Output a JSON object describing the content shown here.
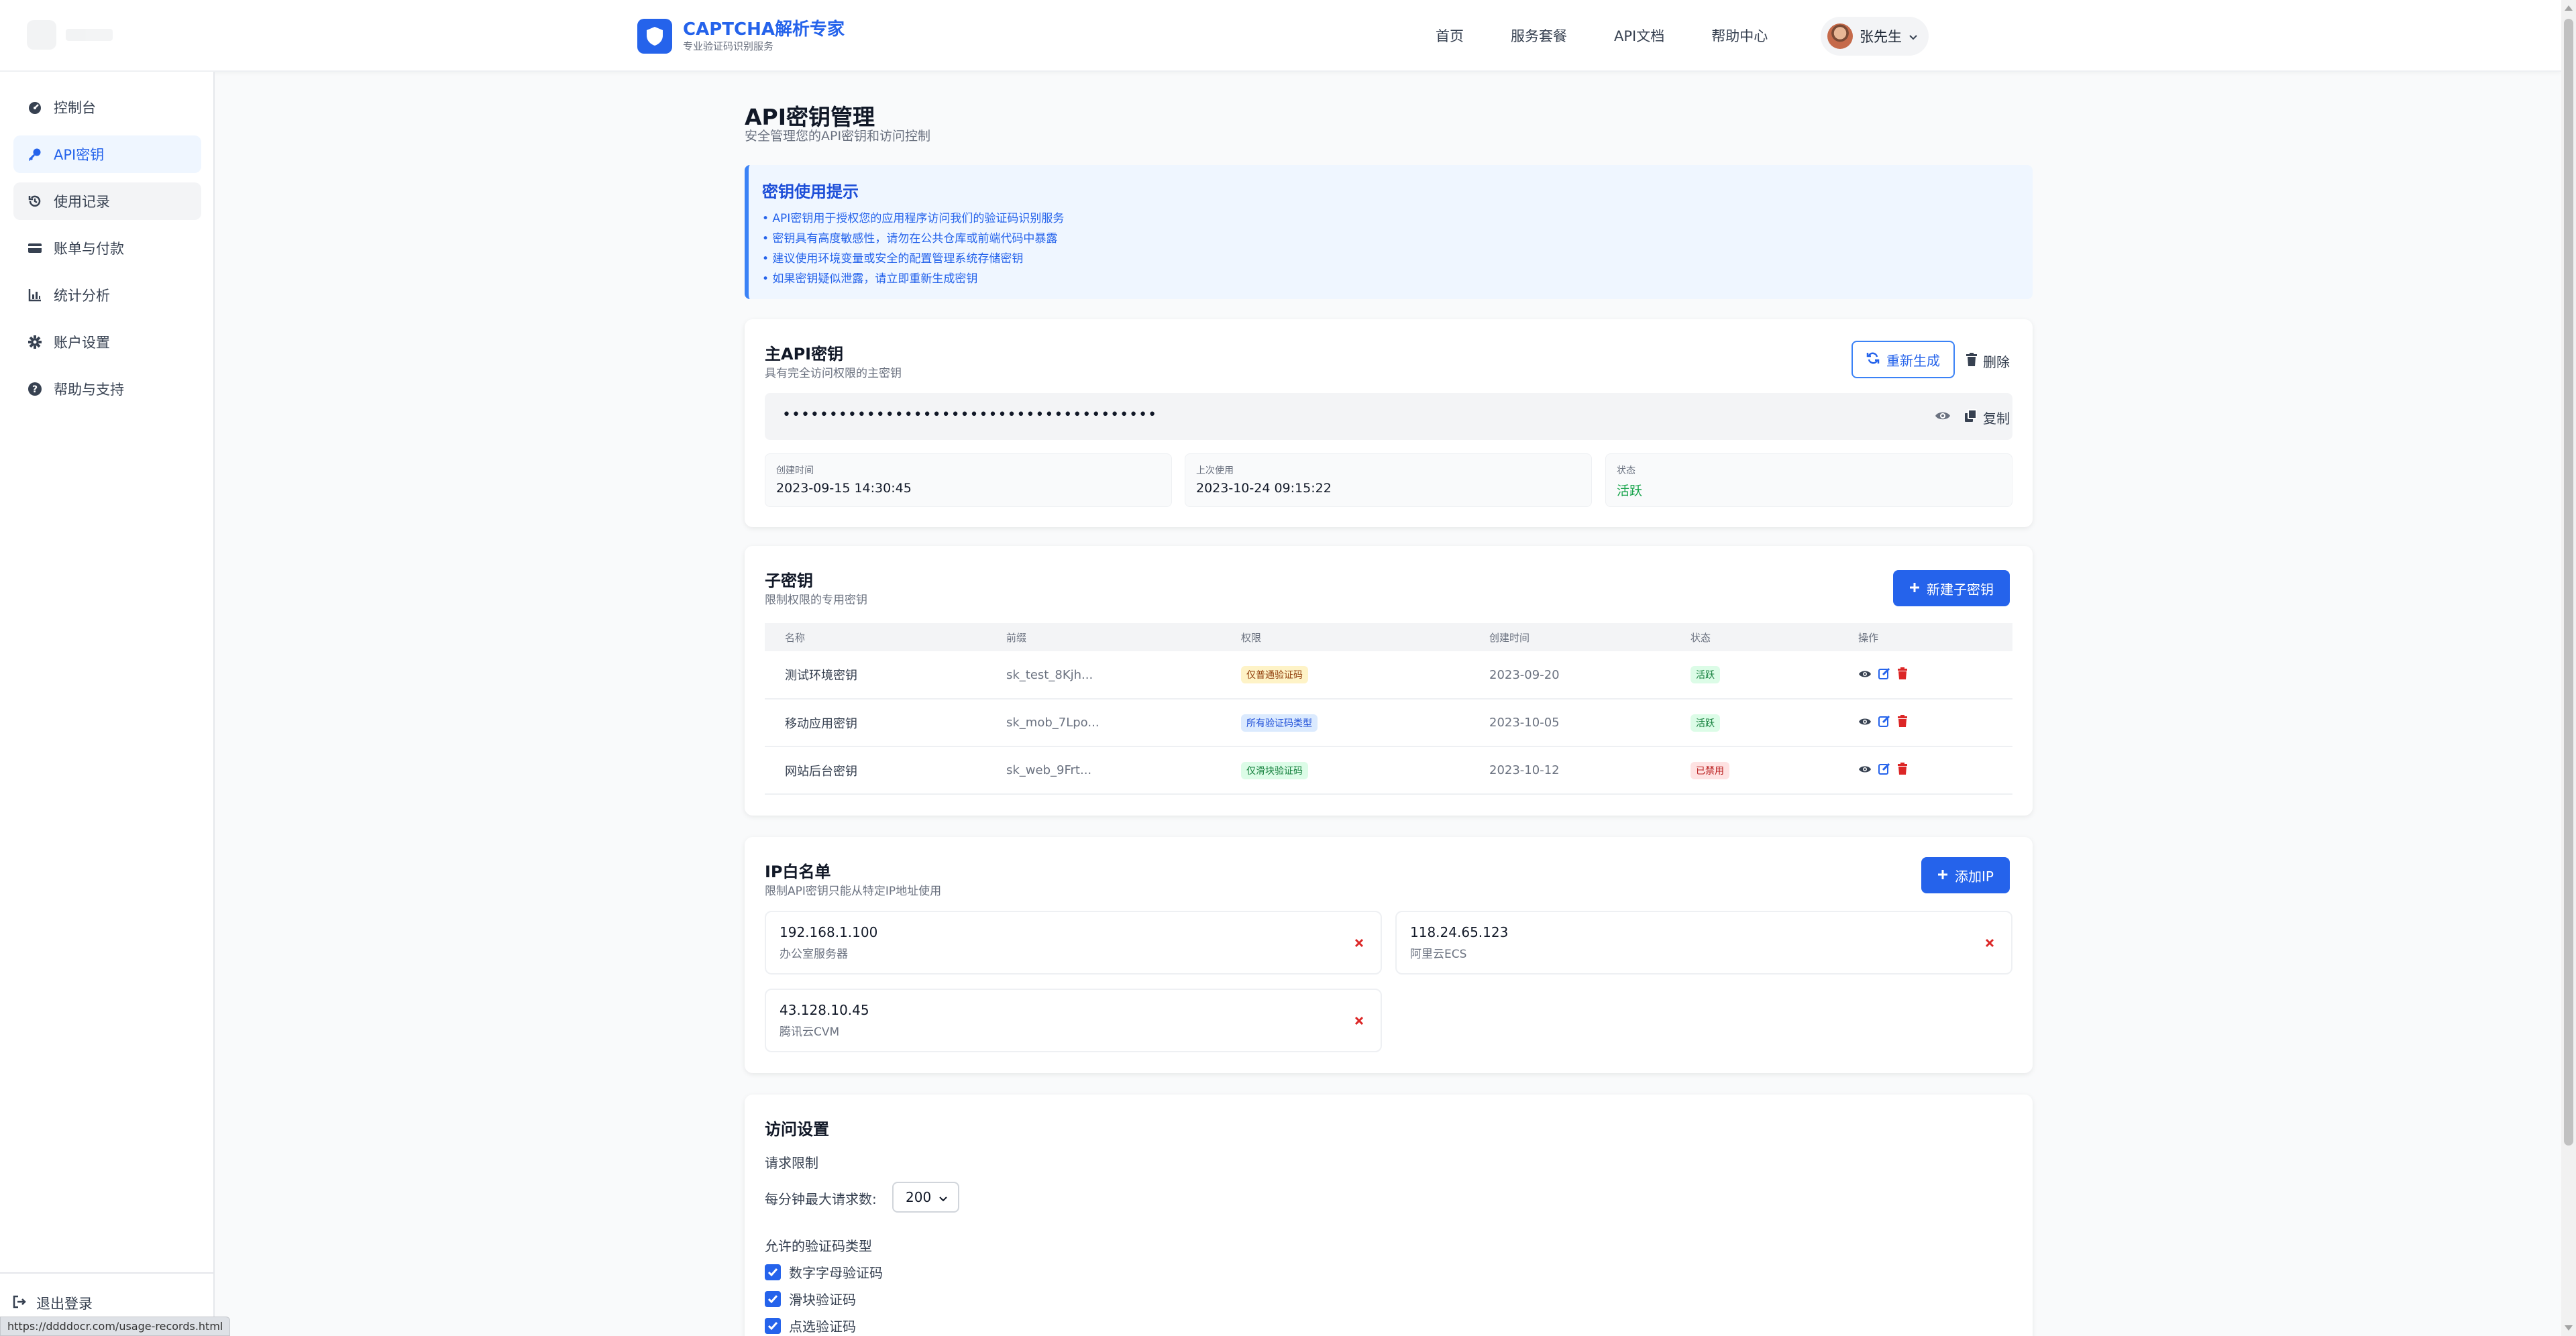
{
  "brand": {
    "title": "CAPTCHA解析专家",
    "subtitle": "专业验证码识别服务"
  },
  "nav": [
    "首页",
    "服务套餐",
    "API文档",
    "帮助中心"
  ],
  "user": {
    "name": "张先生"
  },
  "sidebar": {
    "items": [
      {
        "label": "控制台",
        "icon": "dashboard-icon"
      },
      {
        "label": "API密钥",
        "icon": "key-icon",
        "active": true
      },
      {
        "label": "使用记录",
        "icon": "history-icon"
      },
      {
        "label": "账单与付款",
        "icon": "credit-card-icon"
      },
      {
        "label": "统计分析",
        "icon": "chart-icon"
      },
      {
        "label": "账户设置",
        "icon": "gear-icon"
      },
      {
        "label": "帮助与支持",
        "icon": "question-icon"
      }
    ],
    "logout": "退出登录"
  },
  "status_url": "https://ddddocr.com/usage-records.html",
  "page": {
    "title": "API密钥管理",
    "subtitle": "安全管理您的API密钥和访问控制"
  },
  "tip": {
    "title": "密钥使用提示",
    "lines": [
      "• API密钥用于授权您的应用程序访问我们的验证码识别服务",
      "• 密钥具有高度敏感性，请勿在公共仓库或前端代码中暴露",
      "• 建议使用环境变量或安全的配置管理系统存储密钥",
      "• 如果密钥疑似泄露，请立即重新生成密钥"
    ]
  },
  "main_key": {
    "title": "主API密钥",
    "subtitle": "具有完全访问权限的主密钥",
    "regenerate": "重新生成",
    "delete": "删除",
    "masked": "••••••••••••••••••••••••••••••••••••••••",
    "copy": "复制",
    "created_label": "创建时间",
    "created": "2023-09-15 14:30:45",
    "last_used_label": "上次使用",
    "last_used": "2023-10-24 09:15:22",
    "status_label": "状态",
    "status": "活跃"
  },
  "sub_keys": {
    "title": "子密钥",
    "subtitle": "限制权限的专用密钥",
    "new_button": "新建子密钥",
    "columns": [
      "名称",
      "前缀",
      "权限",
      "创建时间",
      "状态",
      "操作"
    ],
    "rows": [
      {
        "name": "测试环境密钥",
        "prefix": "sk_test_8Kjh...",
        "perm": "仅普通验证码",
        "perm_color": "#92400e",
        "perm_bg": "#fef3c7",
        "date": "2023-09-20",
        "status": "活跃",
        "status_color": "#15803d",
        "status_bg": "#dcfce7"
      },
      {
        "name": "移动应用密钥",
        "prefix": "sk_mob_7Lpo...",
        "perm": "所有验证码类型",
        "perm_color": "#1d4ed8",
        "perm_bg": "#dbeafe",
        "date": "2023-10-05",
        "status": "活跃",
        "status_color": "#15803d",
        "status_bg": "#dcfce7"
      },
      {
        "name": "网站后台密钥",
        "prefix": "sk_web_9Frt...",
        "perm": "仅滑块验证码",
        "perm_color": "#15803d",
        "perm_bg": "#dcfce7",
        "date": "2023-10-12",
        "status": "已禁用",
        "status_color": "#b91c1c",
        "status_bg": "#fee2e2"
      }
    ]
  },
  "ip_whitelist": {
    "title": "IP白名单",
    "subtitle": "限制API密钥只能从特定IP地址使用",
    "add_button": "添加IP",
    "items": [
      {
        "ip": "192.168.1.100",
        "desc": "办公室服务器"
      },
      {
        "ip": "118.24.65.123",
        "desc": "阿里云ECS"
      },
      {
        "ip": "43.128.10.45",
        "desc": "腾讯云CVM"
      }
    ]
  },
  "access": {
    "title": "访问设置",
    "rate_title": "请求限制",
    "rate_label": "每分钟最大请求数:",
    "rate_value": "200",
    "types_title": "允许的验证码类型",
    "types": [
      "数字字母验证码",
      "滑块验证码",
      "点选验证码"
    ]
  },
  "colors": {
    "primary": "#2563eb",
    "danger": "#dc2626",
    "success": "#16a34a"
  }
}
